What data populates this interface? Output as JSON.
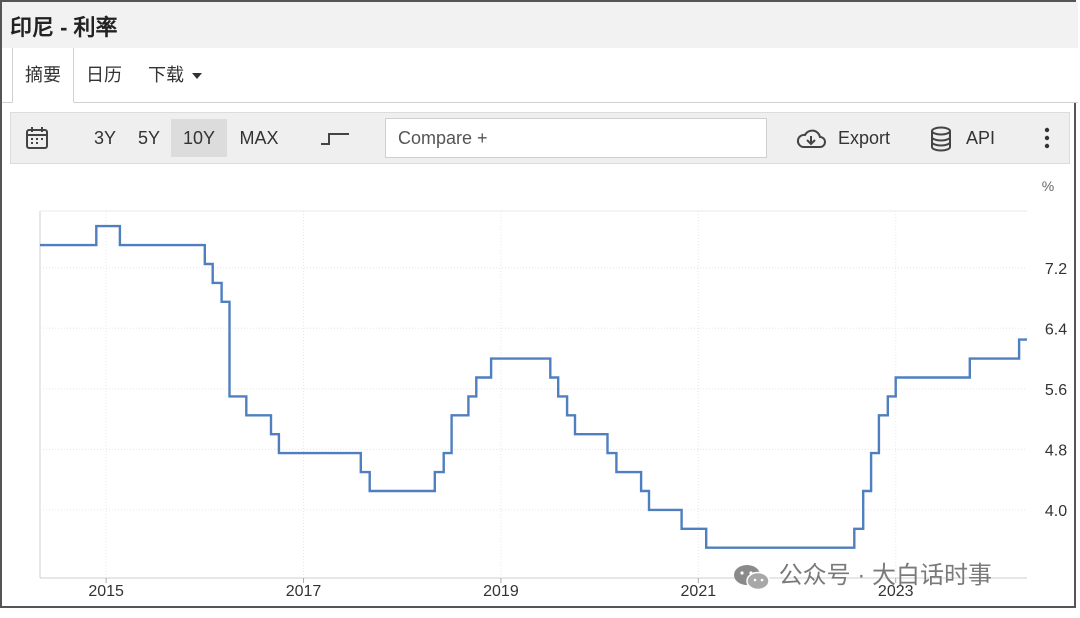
{
  "title": "印尼 - 利率",
  "tabs": [
    {
      "label": "摘要",
      "active": true
    },
    {
      "label": "日历",
      "active": false
    },
    {
      "label": "下载",
      "active": false
    }
  ],
  "toolbar": {
    "ranges": [
      "3Y",
      "5Y",
      "10Y",
      "MAX"
    ],
    "selected_range": "10Y",
    "compare_placeholder": "Compare +",
    "export_label": "Export",
    "api_label": "API"
  },
  "watermark": "公众号 · 大白话时事",
  "colors": {
    "line": "#4f7fbf",
    "grid": "#e6e6e6"
  },
  "chart_data": {
    "type": "line",
    "step": true,
    "unit_label": "%",
    "x_ticks": [
      "2015",
      "2017",
      "2019",
      "2021",
      "2023"
    ],
    "y_ticks": [
      4.0,
      4.8,
      5.6,
      6.4,
      7.2
    ],
    "xlim": [
      2014.33,
      2024.33
    ],
    "ylim": [
      3.1,
      7.95
    ],
    "series": [
      {
        "values": [
          [
            2014.33,
            7.5
          ],
          [
            2014.9,
            7.75
          ],
          [
            2015.14,
            7.5
          ],
          [
            2016.0,
            7.25
          ],
          [
            2016.08,
            7.0
          ],
          [
            2016.17,
            6.75
          ],
          [
            2016.25,
            5.5
          ],
          [
            2016.42,
            5.25
          ],
          [
            2016.67,
            5.0
          ],
          [
            2016.75,
            4.75
          ],
          [
            2017.58,
            4.5
          ],
          [
            2017.67,
            4.25
          ],
          [
            2018.33,
            4.5
          ],
          [
            2018.42,
            4.75
          ],
          [
            2018.5,
            5.25
          ],
          [
            2018.67,
            5.5
          ],
          [
            2018.75,
            5.75
          ],
          [
            2018.9,
            6.0
          ],
          [
            2019.5,
            5.75
          ],
          [
            2019.58,
            5.5
          ],
          [
            2019.67,
            5.25
          ],
          [
            2019.75,
            5.0
          ],
          [
            2020.08,
            4.75
          ],
          [
            2020.17,
            4.5
          ],
          [
            2020.42,
            4.25
          ],
          [
            2020.5,
            4.0
          ],
          [
            2020.83,
            3.75
          ],
          [
            2021.08,
            3.5
          ],
          [
            2022.58,
            3.75
          ],
          [
            2022.67,
            4.25
          ],
          [
            2022.75,
            4.75
          ],
          [
            2022.83,
            5.25
          ],
          [
            2022.92,
            5.5
          ],
          [
            2023.0,
            5.75
          ],
          [
            2023.75,
            6.0
          ],
          [
            2024.25,
            6.25
          ]
        ]
      }
    ]
  }
}
